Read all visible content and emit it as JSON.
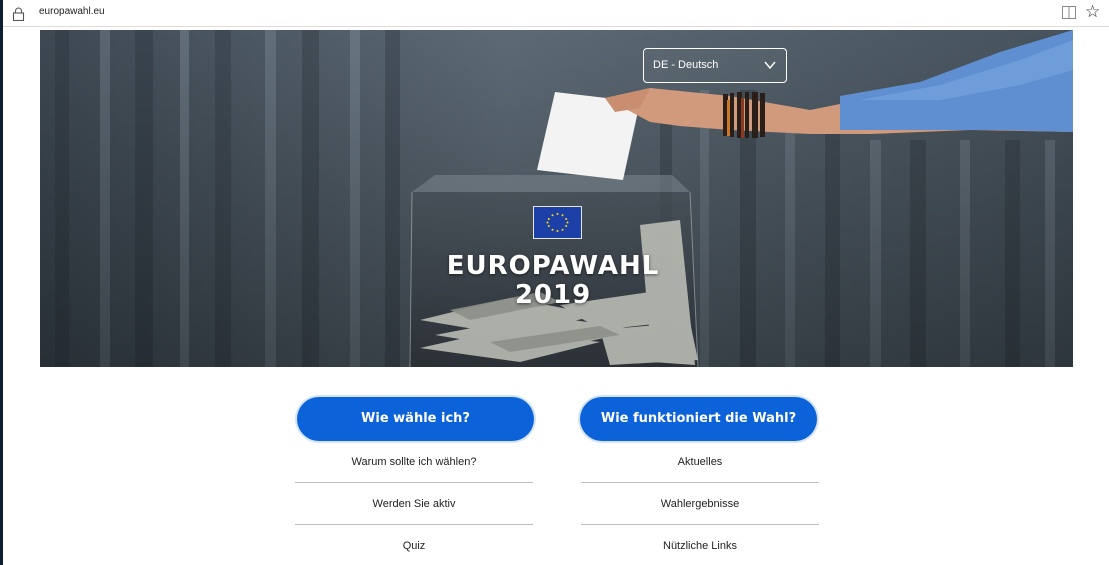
{
  "browser": {
    "url": "europawahl.eu"
  },
  "hero": {
    "language_selected": "DE - Deutsch",
    "title_line1": "EUROPAWAHL",
    "title_line2": "2019"
  },
  "buttons": {
    "left": "Wie wähle ich?",
    "right": "Wie funktioniert die Wahl?"
  },
  "links": {
    "left": [
      "Warum sollte ich wählen?",
      "Werden Sie aktiv",
      "Quiz"
    ],
    "right": [
      "Aktuelles",
      "Wahlergebnisse",
      "Nützliche Links"
    ]
  },
  "colors": {
    "primary_button": "#0c62d8",
    "eu_blue": "#1d3fa8",
    "eu_star": "#ffdd00"
  }
}
